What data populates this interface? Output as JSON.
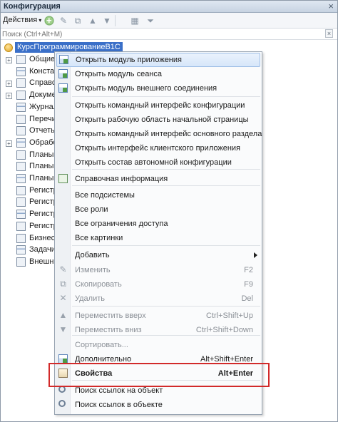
{
  "window": {
    "title": "Конфигурация",
    "close_glyph": "×"
  },
  "toolbar": {
    "actions_label": "Действия",
    "caret": "▾"
  },
  "search": {
    "placeholder": "Поиск (Ctrl+Alt+M)",
    "clear_glyph": "×"
  },
  "tree": {
    "root_label": "КурсПрограммированиеВ1С",
    "nodes": [
      {
        "label": "Общие",
        "expandable": true
      },
      {
        "label": "Констан",
        "expandable": false
      },
      {
        "label": "Справоч",
        "expandable": true
      },
      {
        "label": "Докуме",
        "expandable": true
      },
      {
        "label": "Журнал",
        "expandable": false
      },
      {
        "label": "Перечис",
        "expandable": false
      },
      {
        "label": "Отчеты",
        "expandable": false
      },
      {
        "label": "Обрабо",
        "expandable": true
      },
      {
        "label": "Планы в",
        "expandable": false
      },
      {
        "label": "Планы с",
        "expandable": false
      },
      {
        "label": "Планы в",
        "expandable": false
      },
      {
        "label": "Регистр",
        "expandable": false
      },
      {
        "label": "Регистр",
        "expandable": false
      },
      {
        "label": "Регистр",
        "expandable": false
      },
      {
        "label": "Регистр",
        "expandable": false
      },
      {
        "label": "Бизнес-",
        "expandable": false
      },
      {
        "label": "Задачи",
        "expandable": false
      },
      {
        "label": "Внешни",
        "expandable": false
      }
    ]
  },
  "menu": {
    "items": [
      {
        "label": "Открыть модуль приложения",
        "shortcut": "",
        "icon": "module-icon",
        "disabled": false,
        "highlighted": true
      },
      {
        "label": "Открыть модуль сеанса",
        "shortcut": "",
        "icon": "module-icon",
        "disabled": false
      },
      {
        "label": "Открыть модуль внешнего соединения",
        "shortcut": "",
        "icon": "module-icon",
        "disabled": false
      },
      {
        "label": "Открыть командный интерфейс конфигурации",
        "shortcut": "",
        "icon": "",
        "disabled": false
      },
      {
        "label": "Открыть рабочую область начальной страницы",
        "shortcut": "",
        "icon": "",
        "disabled": false
      },
      {
        "label": "Открыть командный интерфейс основного раздела",
        "shortcut": "",
        "icon": "",
        "disabled": false
      },
      {
        "label": "Открыть интерфейс клиентского приложения",
        "shortcut": "",
        "icon": "",
        "disabled": false
      },
      {
        "label": "Открыть состав автономной конфигурации",
        "shortcut": "",
        "icon": "",
        "disabled": false
      },
      {
        "label": "Справочная информация",
        "shortcut": "",
        "icon": "help-icon",
        "disabled": false
      },
      {
        "label": "Все подсистемы",
        "shortcut": "",
        "icon": "",
        "disabled": false
      },
      {
        "label": "Все роли",
        "shortcut": "",
        "icon": "",
        "disabled": false
      },
      {
        "label": "Все ограничения доступа",
        "shortcut": "",
        "icon": "",
        "disabled": false
      },
      {
        "label": "Все картинки",
        "shortcut": "",
        "icon": "",
        "disabled": false
      },
      {
        "label": "Добавить",
        "shortcut": "",
        "icon": "",
        "disabled": false,
        "submenu": true
      },
      {
        "label": "Изменить",
        "shortcut": "F2",
        "icon": "pencil-icon",
        "disabled": true
      },
      {
        "label": "Скопировать",
        "shortcut": "F9",
        "icon": "copy-icon",
        "disabled": true
      },
      {
        "label": "Удалить",
        "shortcut": "Del",
        "icon": "delete-icon",
        "disabled": true
      },
      {
        "label": "Переместить вверх",
        "shortcut": "Ctrl+Shift+Up",
        "icon": "arrow-up-icon",
        "disabled": true
      },
      {
        "label": "Переместить вниз",
        "shortcut": "Ctrl+Shift+Down",
        "icon": "arrow-down-icon",
        "disabled": true
      },
      {
        "label": "Сортировать...",
        "shortcut": "",
        "icon": "",
        "disabled": true
      },
      {
        "label": "Дополнительно",
        "shortcut": "Alt+Shift+Enter",
        "icon": "extra-icon",
        "disabled": false
      },
      {
        "label": "Свойства",
        "shortcut": "Alt+Enter",
        "icon": "properties-icon",
        "disabled": false,
        "bold": true
      },
      {
        "label": "Поиск ссылок на объект",
        "shortcut": "",
        "icon": "search-icon",
        "disabled": false
      },
      {
        "label": "Поиск ссылок в объекте",
        "shortcut": "",
        "icon": "search-icon",
        "disabled": false
      }
    ]
  },
  "colors": {
    "selection": "#3a6fc8",
    "annotation_box": "#d22a2a"
  }
}
